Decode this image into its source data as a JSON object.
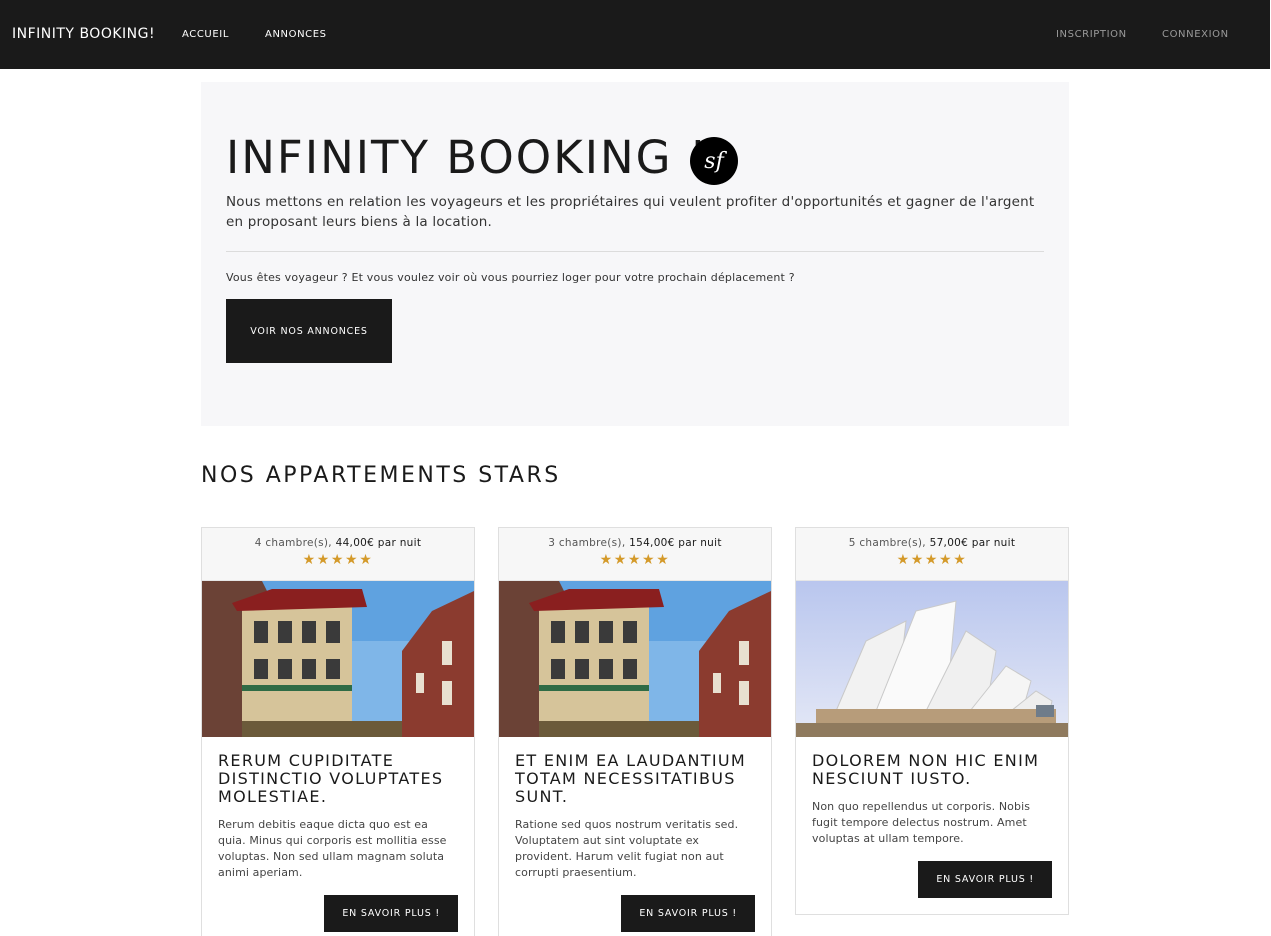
{
  "navbar": {
    "brand": "INFINITY BOOKING!",
    "left_links": [
      "ACCUEIL",
      "ANNONCES"
    ],
    "right_links": [
      "INSCRIPTION",
      "CONNEXION"
    ]
  },
  "hero": {
    "title": "INFINITY BOOKING !",
    "logo_letters": "sf",
    "lead": "Nous mettons en relation les voyageurs et les propriétaires qui veulent profiter d'opportunités et gagner de l'argent en proposant leurs biens à la location.",
    "question": "Vous êtes voyageur ? Et vous voulez voir où vous pourriez loger pour votre prochain déplacement ?",
    "button": "VOIR NOS ANNONCES"
  },
  "section_title": "NOS APPARTEMENTS STARS",
  "listings": [
    {
      "rooms": "4 chambre(s),",
      "price": "44,00€ par nuit",
      "rating": 5,
      "stars": "★★★★★",
      "image": "chinatown-building-photo",
      "title": "RERUM CUPIDITATE DISTINCTIO VOLUPTATES MOLESTIAE.",
      "description": "Rerum debitis eaque dicta quo est ea quia. Minus qui corporis est mollitia esse voluptas. Non sed ullam magnam soluta animi aperiam.",
      "button": "EN SAVOIR PLUS !"
    },
    {
      "rooms": "3 chambre(s),",
      "price": "154,00€ par nuit",
      "rating": 5,
      "stars": "★★★★★",
      "image": "chinatown-building-photo",
      "title": "ET ENIM EA LAUDANTIUM TOTAM NECESSITATIBUS SUNT.",
      "description": "Ratione sed quos nostrum veritatis sed. Voluptatem aut sint voluptate ex provident. Harum velit fugiat non aut corrupti praesentium.",
      "button": "EN SAVOIR PLUS !"
    },
    {
      "rooms": "5 chambre(s),",
      "price": "57,00€ par nuit",
      "rating": 5,
      "stars": "★★★★★",
      "image": "opera-house-photo",
      "title": "DOLOREM NON HIC ENIM NESCIUNT IUSTO.",
      "description": "Non quo repellendus ut corporis. Nobis fugit tempore delectus nostrum. Amet voluptas at ullam tempore.",
      "button": "EN SAVOIR PLUS !"
    }
  ],
  "colors": {
    "navbar": "#1a1a1a",
    "hero_bg": "#f7f7f9",
    "star": "#d49a2a",
    "button": "#1a1a1a"
  }
}
